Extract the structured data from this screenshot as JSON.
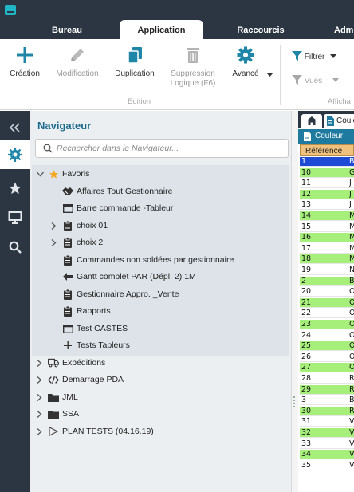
{
  "menu": {
    "tabs": [
      "Bureau",
      "Application",
      "Raccourcis",
      "Adm"
    ],
    "active": "Application"
  },
  "ribbon": {
    "buttons": {
      "creation": "Création",
      "modification": "Modification",
      "duplication": "Duplication",
      "suppression_line1": "Suppression",
      "suppression_line2": "Logique (F6)",
      "avance": "Avancé"
    },
    "group_edition": "Edition",
    "filtrer": "Filtrer",
    "vues": "Vues",
    "group_affichage": "Afficha"
  },
  "colors": {
    "dark": "#2b3642",
    "accent": "#20b6c8",
    "nav_title": "#1b6a8c",
    "grid_green": "#a7ef7b",
    "grid_header": "#f1c27d",
    "selected_row": "#1e4bd6"
  },
  "navigator": {
    "title": "Navigateur",
    "search_placeholder": "Rechercher dans le Navigateur...",
    "favoris_label": "Favoris",
    "favoris_items": [
      {
        "label": "Affaires Tout Gestionnaire",
        "icon": "handshake-icon"
      },
      {
        "label": "Barre commande -Tableur",
        "icon": "window-icon"
      },
      {
        "label": "choix 01",
        "icon": "clipboard-icon"
      },
      {
        "label": "choix 2",
        "icon": "clipboard-icon"
      },
      {
        "label": "Commandes non soldées par gestionnaire",
        "icon": "clipboard-icon"
      },
      {
        "label": "Gantt complet PAR (Dépl. 2) 1M",
        "icon": "arrow-left-icon"
      },
      {
        "label": "Gestionnaire Appro. _Vente",
        "icon": "clipboard-icon"
      },
      {
        "label": "Rapports",
        "icon": "clipboard-icon"
      },
      {
        "label": "Test CASTES",
        "icon": "window-icon"
      },
      {
        "label": "Tests Tableurs",
        "icon": "chart-icon"
      }
    ],
    "root_items": [
      {
        "label": "Expéditions",
        "icon": "truck-icon"
      },
      {
        "label": "Demarrage PDA",
        "icon": "code-icon"
      },
      {
        "label": "JML",
        "icon": "folder-icon"
      },
      {
        "label": "SSA",
        "icon": "folder-icon"
      },
      {
        "label": "PLAN TESTS (04.16.19)",
        "icon": "play-icon"
      }
    ]
  },
  "content": {
    "tab_label": "Coule",
    "subtab_label": "Couleur",
    "column_header": "Référence",
    "column_header2": "",
    "rows": [
      {
        "ref": "1",
        "c2": "B",
        "style": "selected"
      },
      {
        "ref": "10",
        "c2": "G",
        "style": "green"
      },
      {
        "ref": "11",
        "c2": "J",
        "style": "white"
      },
      {
        "ref": "12",
        "c2": "J",
        "style": "green"
      },
      {
        "ref": "13",
        "c2": "J",
        "style": "white"
      },
      {
        "ref": "14",
        "c2": "M",
        "style": "green"
      },
      {
        "ref": "15",
        "c2": "M",
        "style": "white"
      },
      {
        "ref": "16",
        "c2": "M",
        "style": "green"
      },
      {
        "ref": "17",
        "c2": "M",
        "style": "white"
      },
      {
        "ref": "18",
        "c2": "M",
        "style": "green"
      },
      {
        "ref": "19",
        "c2": "N",
        "style": "white"
      },
      {
        "ref": "2",
        "c2": "B",
        "style": "green"
      },
      {
        "ref": "20",
        "c2": "O",
        "style": "white"
      },
      {
        "ref": "21",
        "c2": "O",
        "style": "green"
      },
      {
        "ref": "22",
        "c2": "O",
        "style": "white"
      },
      {
        "ref": "23",
        "c2": "O",
        "style": "green"
      },
      {
        "ref": "24",
        "c2": "O",
        "style": "white"
      },
      {
        "ref": "25",
        "c2": "O",
        "style": "green"
      },
      {
        "ref": "26",
        "c2": "O",
        "style": "white"
      },
      {
        "ref": "27",
        "c2": "O",
        "style": "green"
      },
      {
        "ref": "28",
        "c2": "R",
        "style": "white"
      },
      {
        "ref": "29",
        "c2": "R",
        "style": "green"
      },
      {
        "ref": "3",
        "c2": "B",
        "style": "white"
      },
      {
        "ref": "30",
        "c2": "R",
        "style": "green"
      },
      {
        "ref": "31",
        "c2": "V",
        "style": "white"
      },
      {
        "ref": "32",
        "c2": "V",
        "style": "green"
      },
      {
        "ref": "33",
        "c2": "V",
        "style": "white"
      },
      {
        "ref": "34",
        "c2": "V",
        "style": "green"
      },
      {
        "ref": "35",
        "c2": "V",
        "style": "white"
      }
    ]
  }
}
